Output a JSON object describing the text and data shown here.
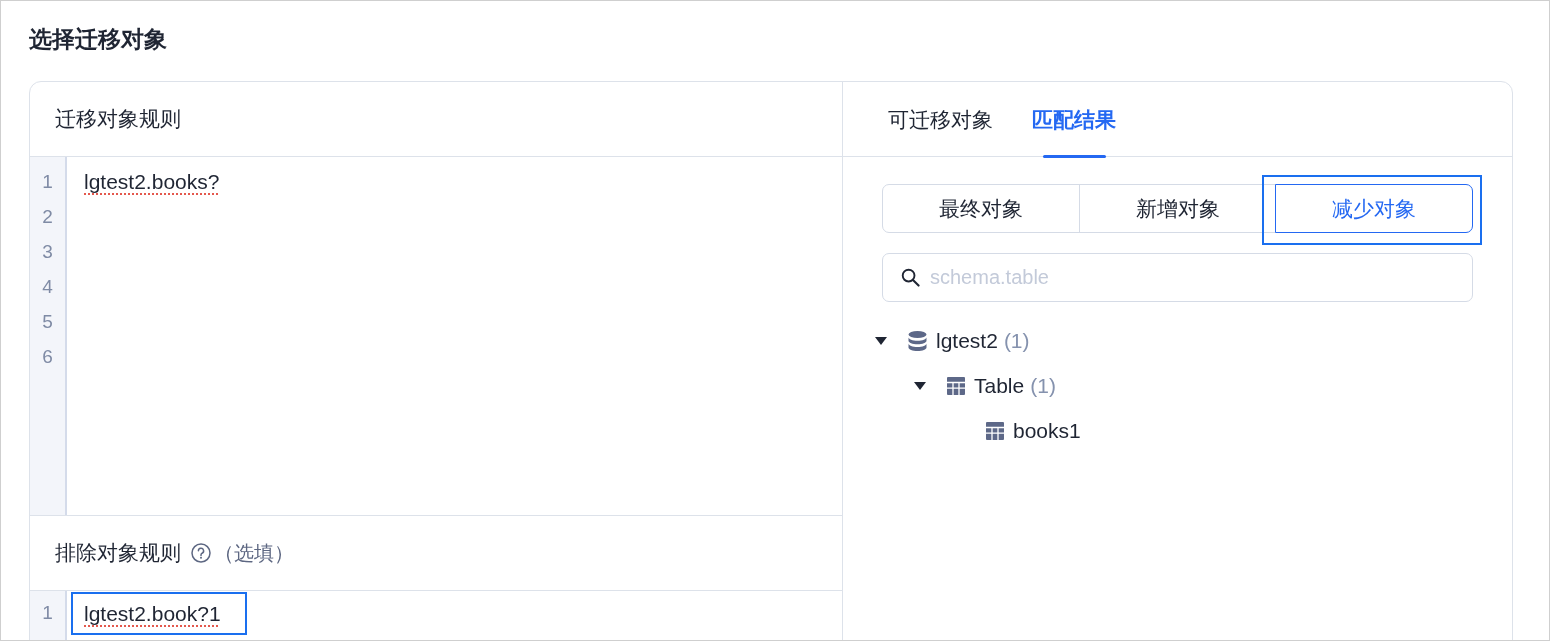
{
  "title": "选择迁移对象",
  "rules_panel": {
    "header": "迁移对象规则",
    "editor": {
      "lines": [
        {
          "number": "1",
          "text": "lgtest2.books?",
          "spell_error": true
        },
        {
          "number": "2"
        },
        {
          "number": "3"
        },
        {
          "number": "4"
        },
        {
          "number": "5"
        },
        {
          "number": "6"
        }
      ]
    }
  },
  "exclude_panel": {
    "header": "排除对象规则",
    "hint": "（选填）",
    "editor": {
      "lines": [
        {
          "number": "1",
          "text": "lgtest2.book?1",
          "spell_error": true,
          "highlighted": true
        }
      ]
    }
  },
  "results_panel": {
    "tabs": [
      {
        "label": "可迁移对象",
        "selected": false
      },
      {
        "label": "匹配结果",
        "selected": true
      }
    ],
    "segments": [
      {
        "label": "最终对象",
        "selected": false,
        "highlighted": false
      },
      {
        "label": "新增对象",
        "selected": false,
        "highlighted": false
      },
      {
        "label": "减少对象",
        "selected": true,
        "highlighted": true
      }
    ],
    "search": {
      "placeholder": "schema.table"
    },
    "tree": [
      {
        "kind": "database",
        "label": "lgtest2",
        "count": "(1)",
        "expanded": true,
        "children": [
          {
            "kind": "group",
            "label": "Table",
            "count": "(1)",
            "expanded": true,
            "children": [
              {
                "kind": "table",
                "label": "books1"
              }
            ]
          }
        ]
      }
    ]
  }
}
